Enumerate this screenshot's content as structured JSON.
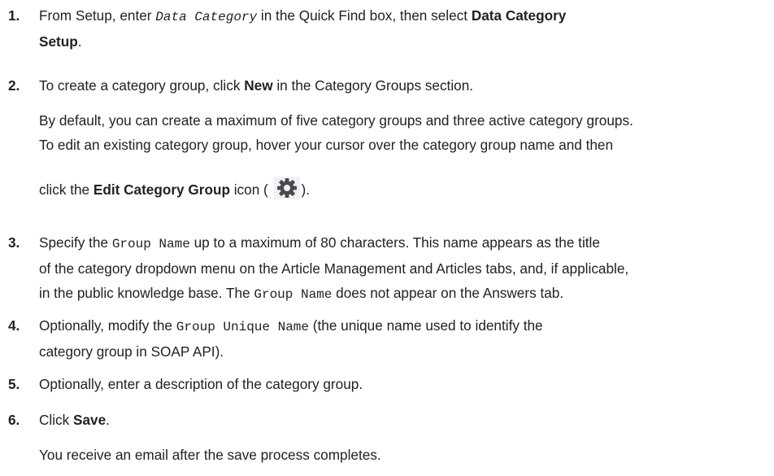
{
  "steps": [
    {
      "number": "1.",
      "t1": "From Setup, enter ",
      "code1": "Data Category",
      "t2": " in the Quick Find box, then select ",
      "bold1": "Data Category",
      "bold2": "Setup",
      "t3": "."
    },
    {
      "number": "2.",
      "t1": "To create a category group, click ",
      "bold1": "New",
      "t2": " in the Category Groups section.",
      "note_line1": "By default, you can create a maximum of five category groups and three active category groups.",
      "note_line2": "To edit an existing category group, hover your cursor over the category group name and then",
      "note_line3_a": "click the ",
      "note_line3_bold": "Edit Category Group",
      "note_line3_b": " icon (",
      "note_line3_c": ").",
      "icon": "gear-icon"
    },
    {
      "number": "3.",
      "t1": "Specify the ",
      "code1": "Group Name",
      "t2": " up to a maximum of 80 characters. This name appears as the title",
      "line2": "of the category dropdown menu on the Article Management and Articles tabs, and, if applicable,",
      "t3": "in the public knowledge base. The ",
      "code2": "Group Name",
      "t4": " does not appear on the Answers tab."
    },
    {
      "number": "4.",
      "t1": "Optionally, modify the ",
      "code1": "Group Unique Name",
      "t2": " (the unique name used to identify the",
      "line2": "category group in SOAP API)."
    },
    {
      "number": "5.",
      "t1": "Optionally, enter a description of the category group."
    },
    {
      "number": "6.",
      "t1": "Click ",
      "bold1": "Save",
      "t2": ".",
      "note": "You receive an email after the save process completes."
    }
  ]
}
